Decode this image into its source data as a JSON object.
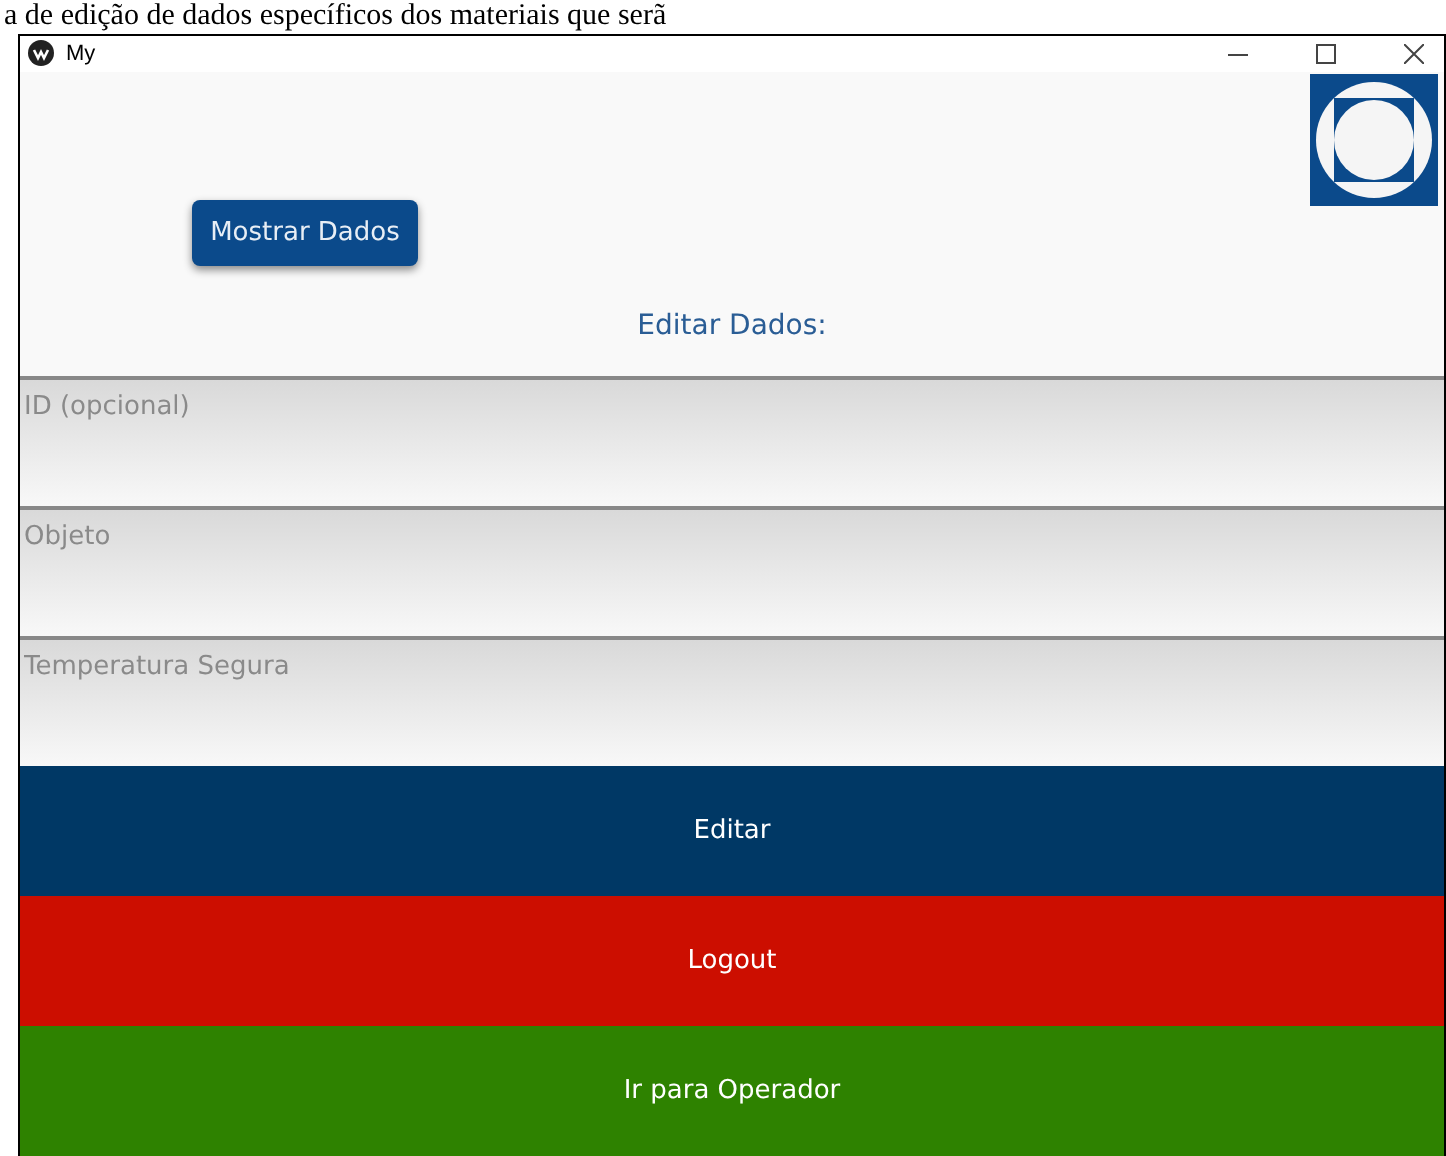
{
  "caption": "a de edição de dados específicos dos materiais que serã",
  "window": {
    "title": "My"
  },
  "show_button": "Mostrar Dados",
  "heading": "Editar Dados:",
  "fields": [
    {
      "placeholder": "ID (opcional)"
    },
    {
      "placeholder": "Objeto"
    },
    {
      "placeholder": "Temperatura Segura"
    }
  ],
  "actions": [
    {
      "label": "Editar",
      "color": "#003865"
    },
    {
      "label": "Logout",
      "color": "#cc0e00"
    },
    {
      "label": "Ir para Operador",
      "color": "#2e8200"
    }
  ]
}
